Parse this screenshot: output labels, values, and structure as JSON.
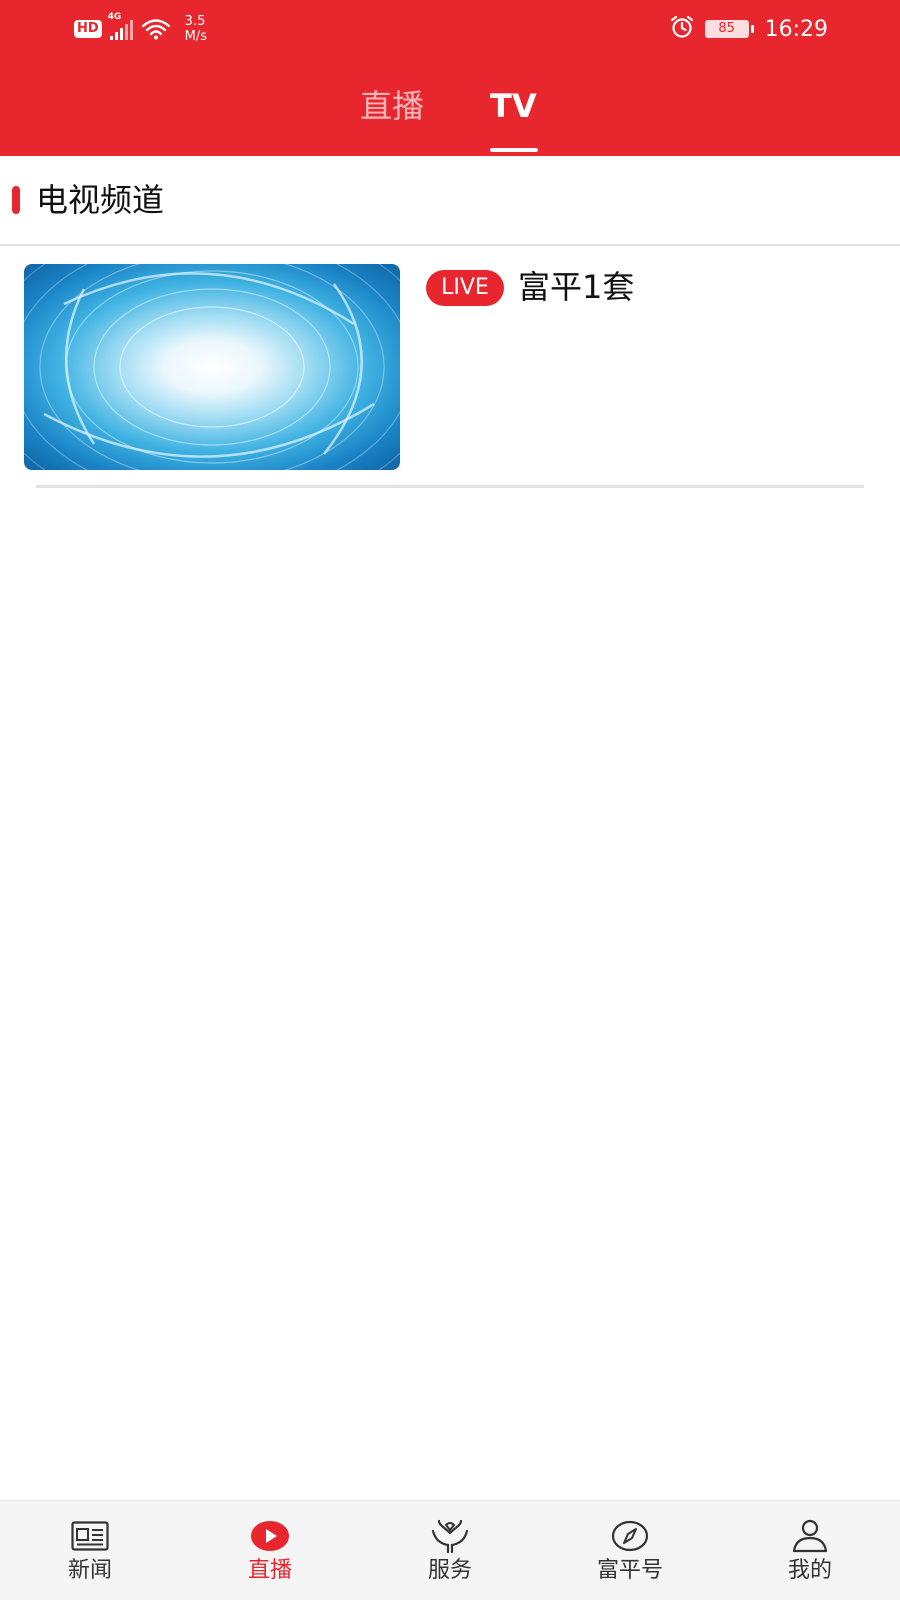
{
  "colors": {
    "brand": "#E8262E",
    "tab_inactive": "#F7B6B9",
    "divider": "#E2E2E2",
    "nav_background": "#F5F5F5"
  },
  "status_bar": {
    "hd_badge": "HD",
    "network": "4G",
    "speed_value": "3.5",
    "speed_unit": "M/s",
    "battery": "85",
    "time": "16:29",
    "icons": [
      "signal-icon",
      "wifi-icon",
      "alarm-icon",
      "battery-icon"
    ]
  },
  "top_tabs": [
    {
      "label": "直播",
      "active": false
    },
    {
      "label": "TV",
      "active": true
    }
  ],
  "section": {
    "title": "电视频道"
  },
  "channels": [
    {
      "badge": "LIVE",
      "name": "富平1套",
      "thumbnail": "blue-swirl-thumbnail"
    }
  ],
  "bottom_nav": [
    {
      "label": "新闻",
      "icon": "newspaper-icon",
      "active": false
    },
    {
      "label": "直播",
      "icon": "play-icon",
      "active": true
    },
    {
      "label": "服务",
      "icon": "hands-heart-icon",
      "active": false
    },
    {
      "label": "富平号",
      "icon": "compass-icon",
      "active": false
    },
    {
      "label": "我的",
      "icon": "person-icon",
      "active": false
    }
  ]
}
